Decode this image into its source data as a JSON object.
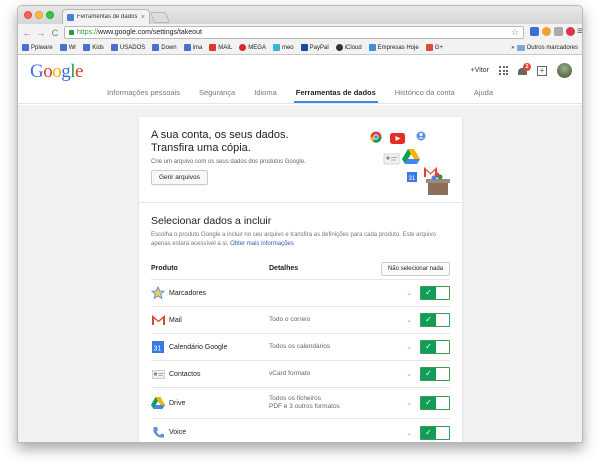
{
  "browser": {
    "tab_title": "Ferramentas de dados - Tr",
    "tab_close": "×",
    "url_scheme": "https://",
    "url_rest": "www.google.com/settings/takeout",
    "nav_back": "←",
    "nav_forward": "→",
    "nav_reload": "C",
    "star": "☆",
    "menu": "≡",
    "overflow": "»"
  },
  "bookmarks": {
    "items": [
      {
        "label": "Ppiware"
      },
      {
        "label": "Wr"
      },
      {
        "label": "Kids"
      },
      {
        "label": "USADOS"
      },
      {
        "label": "Down"
      },
      {
        "label": "ima"
      },
      {
        "label": "MAIL"
      },
      {
        "label": "MEGA"
      },
      {
        "label": "meo"
      },
      {
        "label": "PayPal"
      },
      {
        "label": "iCloud"
      },
      {
        "label": "Empresas Hoje"
      },
      {
        "label": "G+"
      }
    ],
    "other": "Outros marcadores"
  },
  "header": {
    "logo": [
      "G",
      "o",
      "o",
      "g",
      "l",
      "e"
    ],
    "plus_user": "+Vitor",
    "notification_count": "2",
    "share_icon": "+"
  },
  "nav": {
    "items": [
      {
        "label": "Informações pessoais"
      },
      {
        "label": "Segurança"
      },
      {
        "label": "Idioma"
      },
      {
        "label": "Ferramentas de dados"
      },
      {
        "label": "Histórico da conta"
      },
      {
        "label": "Ajuda"
      }
    ],
    "active": "Ferramentas de dados"
  },
  "intro": {
    "title_line1": "A sua conta, os seus dados.",
    "title_line2": "Transfira uma cópia.",
    "subtitle": "Crie um arquivo com os seus dados dos produtos Google.",
    "button": "Gerir arquivos"
  },
  "selection": {
    "title": "Selecionar dados a incluir",
    "description": "Escolha o produto Google a incluir no seu arquivo e transfira as definições para cada produto. Este arquivo apenas estará acessível a si.",
    "link": "Obter mais informações",
    "col_product": "Produto",
    "col_details": "Detalhes",
    "select_none": "Não selecionar nada",
    "chevron": "⌄",
    "check": "✓",
    "rows": [
      {
        "name": "Marcadores",
        "details": "",
        "details2": "",
        "icon": "star-icon"
      },
      {
        "name": "Mail",
        "details": "Todo o correio",
        "details2": "",
        "icon": "gmail-icon"
      },
      {
        "name": "Calendário Google",
        "details": "Todos os calendários",
        "details2": "",
        "icon": "calendar-icon"
      },
      {
        "name": "Contactos",
        "details": "vCard formato",
        "details2": "",
        "icon": "contacts-icon"
      },
      {
        "name": "Drive",
        "details": "Todos os ficheiros",
        "details2": "PDF e 3 outros formatos",
        "icon": "drive-icon"
      },
      {
        "name": "Voice",
        "details": "",
        "details2": "",
        "icon": "voice-icon"
      }
    ]
  },
  "colors": {
    "accent_blue": "#4285f4",
    "toggle_green": "#0f9d58",
    "link": "#2a5db0",
    "badge_red": "#dd4b39"
  }
}
